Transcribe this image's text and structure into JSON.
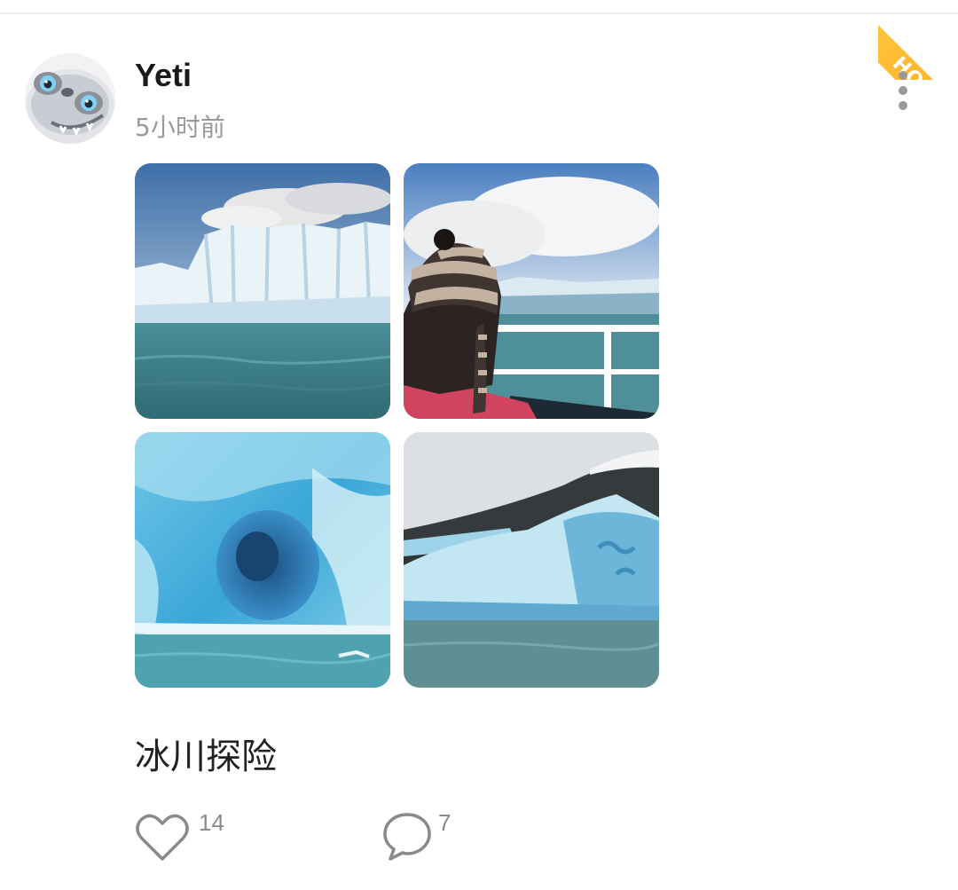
{
  "badge": {
    "label": "HOT",
    "color": "#ffb52a"
  },
  "post": {
    "author": {
      "name": "Yeti",
      "avatar_icon": "yeti-avatar-icon"
    },
    "time": "5小时前",
    "caption": "冰川探险",
    "photos": [
      {
        "name": "glacier-wall-photo"
      },
      {
        "name": "boat-passenger-photo"
      },
      {
        "name": "ice-cave-photo"
      },
      {
        "name": "iceberg-photo"
      }
    ],
    "actions": {
      "likes": {
        "count": "14",
        "icon": "heart-icon"
      },
      "comments": {
        "count": "7",
        "icon": "comment-bubble-icon"
      },
      "more_icon": "more-vertical-icon"
    }
  }
}
